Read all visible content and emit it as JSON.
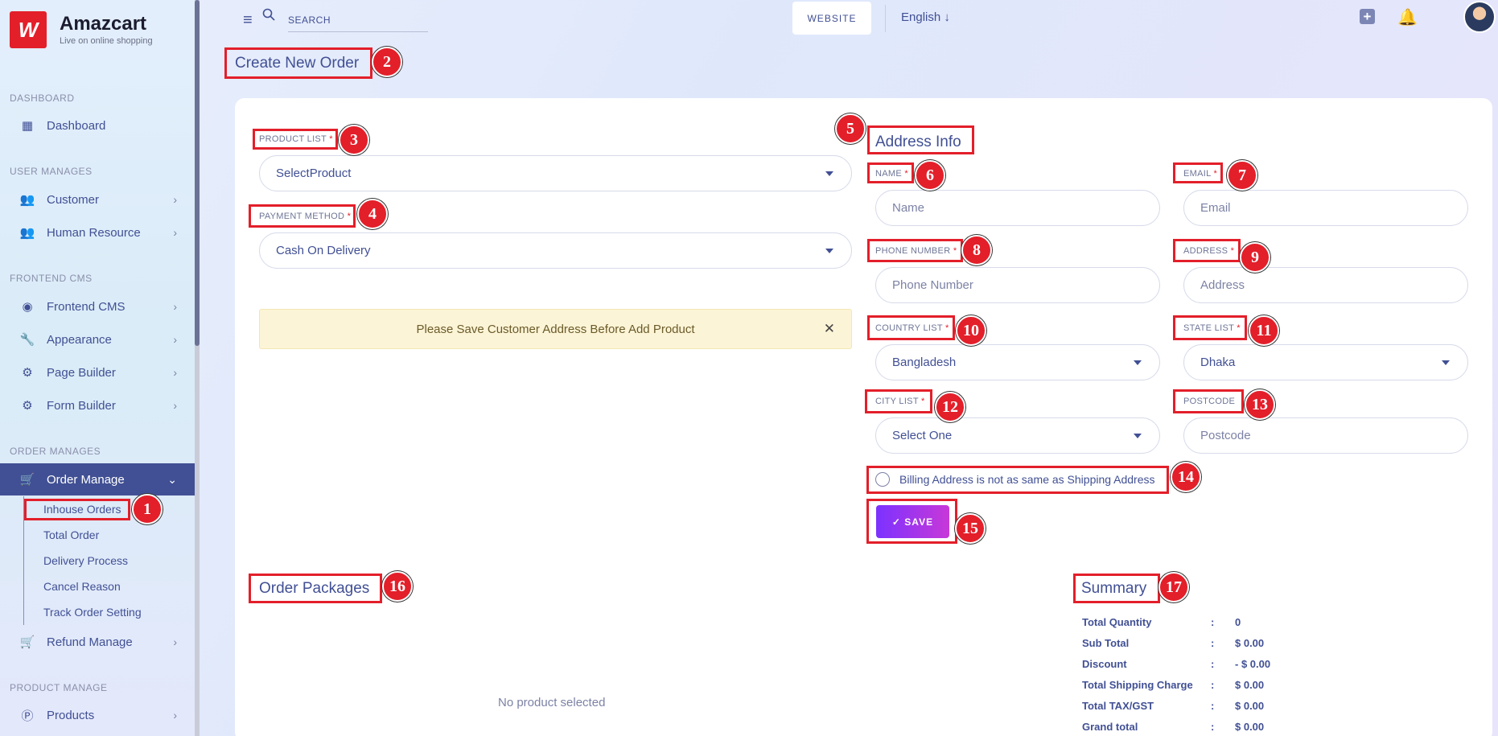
{
  "brand": {
    "name": "Amazcart",
    "tagline": "Live on online shopping",
    "logo_text": "W"
  },
  "sidebar": {
    "sections": {
      "dashboard": "DASHBOARD",
      "user": "USER MANAGES",
      "frontend": "FRONTEND CMS",
      "order": "ORDER MANAGES",
      "product": "PRODUCT MANAGE"
    },
    "items": {
      "dashboard": "Dashboard",
      "customer": "Customer",
      "human_resource": "Human Resource",
      "frontend_cms": "Frontend CMS",
      "appearance": "Appearance",
      "page_builder": "Page Builder",
      "form_builder": "Form Builder",
      "order_manage": "Order Manage",
      "refund_manage": "Refund Manage",
      "products": "Products"
    },
    "order_sub": [
      "Inhouse Orders",
      "Total Order",
      "Delivery Process",
      "Cancel Reason",
      "Track Order Setting"
    ]
  },
  "header": {
    "search_placeholder": "SEARCH",
    "website_label": "WEBSITE",
    "language": "English"
  },
  "page": {
    "title": "Create New Order"
  },
  "form": {
    "product_list_label": "PRODUCT LIST",
    "product_list_value": "SelectProduct",
    "payment_method_label": "PAYMENT METHOD",
    "payment_method_value": "Cash On Delivery",
    "alert_text": "Please Save Customer Address Before Add Product",
    "required_mark": "*"
  },
  "address": {
    "title": "Address Info",
    "name_label": "NAME",
    "name_placeholder": "Name",
    "email_label": "EMAIL",
    "email_placeholder": "Email",
    "phone_label": "PHONE NUMBER",
    "phone_placeholder": "Phone Number",
    "address_label": "ADDRESS",
    "address_placeholder": "Address",
    "country_label": "COUNTRY LIST",
    "country_value": "Bangladesh",
    "state_label": "STATE LIST",
    "state_value": "Dhaka",
    "city_label": "CITY LIST",
    "city_value": "Select One",
    "postcode_label": "POSTCODE",
    "postcode_placeholder": "Postcode",
    "billing_label": "Billing Address is not as same as Shipping Address",
    "save_label": "✓ SAVE"
  },
  "packages": {
    "title": "Order Packages",
    "empty": "No product selected"
  },
  "summary": {
    "title": "Summary",
    "rows": [
      {
        "key": "Total Quantity",
        "sep": ":",
        "value": "0"
      },
      {
        "key": "Sub Total",
        "sep": ":",
        "value": "$ 0.00"
      },
      {
        "key": "Discount",
        "sep": ":",
        "value": "- $ 0.00"
      },
      {
        "key": "Total Shipping Charge",
        "sep": ":",
        "value": "$ 0.00"
      },
      {
        "key": "Total TAX/GST",
        "sep": ":",
        "value": "$ 0.00"
      },
      {
        "key": "Grand total",
        "sep": ":",
        "value": "$ 0.00"
      }
    ]
  },
  "annotations": [
    "1",
    "2",
    "3",
    "4",
    "5",
    "6",
    "7",
    "8",
    "9",
    "10",
    "11",
    "12",
    "13",
    "14",
    "15",
    "16",
    "17"
  ],
  "colors": {
    "accent": "#415094",
    "annotation": "#e31f2a",
    "save_start": "#7c32ff",
    "save_end": "#c738d8"
  }
}
